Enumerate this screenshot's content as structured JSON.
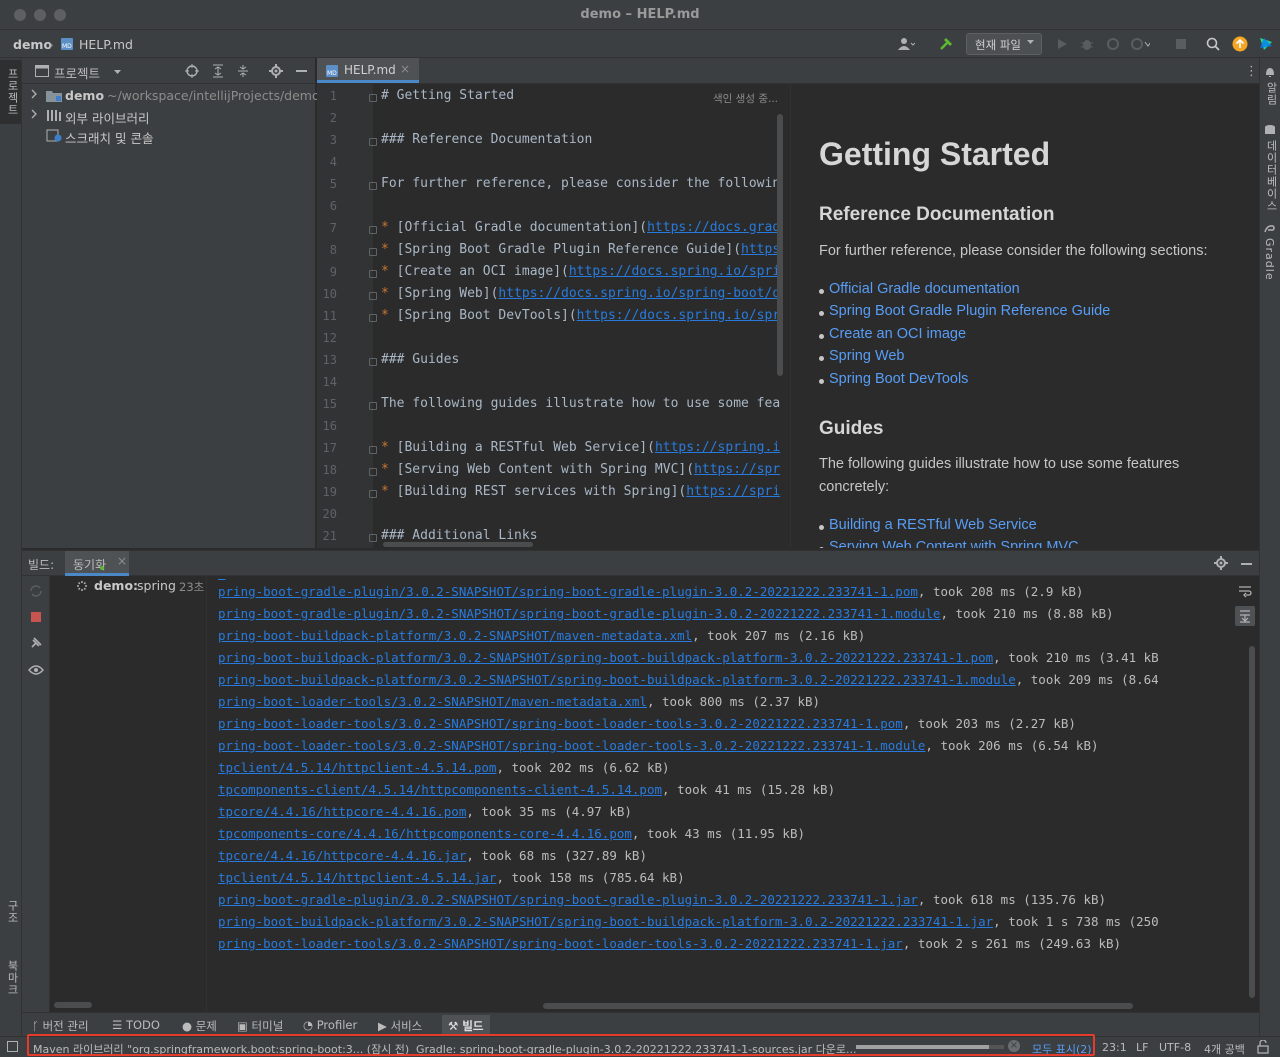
{
  "window": {
    "title": "demo – HELP.md"
  },
  "nav": {
    "project": "demo",
    "file": "HELP.md",
    "run_config": "현재 파일"
  },
  "left_strip": {
    "project_tab": "프로젝트",
    "structure_tab": "구조",
    "bookmarks_tab": "북마크"
  },
  "right_strip": {
    "notifications_tab": "알림",
    "database_tab": "데이터베이스",
    "gradle_tab": "Gradle"
  },
  "project_panel": {
    "title": "프로젝트",
    "tree": [
      {
        "name": "demo",
        "path": "~/workspace/intellijProjects/demo"
      },
      {
        "name": "외부 라이브러리"
      },
      {
        "name": "스크래치 및 콘솔"
      }
    ]
  },
  "editor": {
    "tab": "HELP.md",
    "indexing": "색인 생성 중...",
    "lines": [
      {
        "n": "1",
        "parts": [
          {
            "t": "# Getting Started",
            "c": "plain"
          }
        ]
      },
      {
        "n": "2",
        "parts": []
      },
      {
        "n": "3",
        "parts": [
          {
            "t": "### Reference Documentation",
            "c": "plain"
          }
        ]
      },
      {
        "n": "4",
        "parts": []
      },
      {
        "n": "5",
        "parts": [
          {
            "t": "For further reference, please consider the followin",
            "c": "plain"
          }
        ]
      },
      {
        "n": "6",
        "parts": []
      },
      {
        "n": "7",
        "parts": [
          {
            "t": "* ",
            "c": "star"
          },
          {
            "t": "[Official Gradle documentation](",
            "c": "plain"
          },
          {
            "t": "https://docs.grad",
            "c": "link"
          }
        ]
      },
      {
        "n": "8",
        "parts": [
          {
            "t": "* ",
            "c": "star"
          },
          {
            "t": "[Spring Boot Gradle Plugin Reference Guide](",
            "c": "plain"
          },
          {
            "t": "https",
            "c": "link"
          }
        ]
      },
      {
        "n": "9",
        "parts": [
          {
            "t": "* ",
            "c": "star"
          },
          {
            "t": "[Create an OCI image](",
            "c": "plain"
          },
          {
            "t": "https://docs.spring.io/spri",
            "c": "link"
          }
        ]
      },
      {
        "n": "10",
        "parts": [
          {
            "t": "* ",
            "c": "star"
          },
          {
            "t": "[Spring Web](",
            "c": "plain"
          },
          {
            "t": "https://docs.spring.io/spring-boot/d",
            "c": "link"
          }
        ]
      },
      {
        "n": "11",
        "parts": [
          {
            "t": "* ",
            "c": "star"
          },
          {
            "t": "[Spring Boot DevTools](",
            "c": "plain"
          },
          {
            "t": "https://docs.spring.io/spr",
            "c": "link"
          }
        ]
      },
      {
        "n": "12",
        "parts": []
      },
      {
        "n": "13",
        "parts": [
          {
            "t": "### Guides",
            "c": "plain"
          }
        ]
      },
      {
        "n": "14",
        "parts": []
      },
      {
        "n": "15",
        "parts": [
          {
            "t": "The following guides illustrate how to use some fea",
            "c": "plain"
          }
        ]
      },
      {
        "n": "16",
        "parts": []
      },
      {
        "n": "17",
        "parts": [
          {
            "t": "* ",
            "c": "star"
          },
          {
            "t": "[Building a RESTful Web Service](",
            "c": "plain"
          },
          {
            "t": "https://spring.i",
            "c": "link"
          }
        ]
      },
      {
        "n": "18",
        "parts": [
          {
            "t": "* ",
            "c": "star"
          },
          {
            "t": "[Serving Web Content with Spring MVC](",
            "c": "plain"
          },
          {
            "t": "https://spr",
            "c": "link"
          }
        ]
      },
      {
        "n": "19",
        "parts": [
          {
            "t": "* ",
            "c": "star"
          },
          {
            "t": "[Building REST services with Spring](",
            "c": "plain"
          },
          {
            "t": "https://spri",
            "c": "link"
          }
        ]
      },
      {
        "n": "20",
        "parts": []
      },
      {
        "n": "21",
        "parts": [
          {
            "t": "### Additional Links",
            "c": "plain"
          }
        ]
      }
    ]
  },
  "preview": {
    "h1": "Getting Started",
    "h2_ref": "Reference Documentation",
    "p_ref": "For further reference, please consider the following sections:",
    "ref_links": [
      "Official Gradle documentation",
      "Spring Boot Gradle Plugin Reference Guide",
      "Create an OCI image",
      "Spring Web",
      "Spring Boot DevTools"
    ],
    "h2_guides": "Guides",
    "p_guides_1": "The following guides illustrate how to use some features",
    "p_guides_2": "concretely:",
    "guide_links": [
      "Building a RESTful Web Service",
      "Serving Web Content with Spring MVC"
    ]
  },
  "build": {
    "label": "빌드:",
    "tab": "동기화",
    "tree_item_name": "demo:",
    "tree_item_rest": "spring",
    "tree_item_time": "23초",
    "log": [
      {
        "link": "pring-boot-gradle-plugin/3.0.2-SNAPSHOT/spring-boot-gradle-plugin-3.0.2-20221222.233741-1.pom",
        "rest": ", took 208 ms (2.9 kB)"
      },
      {
        "link": "pring-boot-gradle-plugin/3.0.2-SNAPSHOT/spring-boot-gradle-plugin-3.0.2-20221222.233741-1.module",
        "rest": ", took 210 ms (8.88 kB)"
      },
      {
        "link": "pring-boot-buildpack-platform/3.0.2-SNAPSHOT/maven-metadata.xml",
        "rest": ", took 207 ms (2.16 kB)"
      },
      {
        "link": "pring-boot-buildpack-platform/3.0.2-SNAPSHOT/spring-boot-buildpack-platform-3.0.2-20221222.233741-1.pom",
        "rest": ", took 210 ms (3.41 kB"
      },
      {
        "link": "pring-boot-buildpack-platform/3.0.2-SNAPSHOT/spring-boot-buildpack-platform-3.0.2-20221222.233741-1.module",
        "rest": ", took 209 ms (8.64"
      },
      {
        "link": "pring-boot-loader-tools/3.0.2-SNAPSHOT/maven-metadata.xml",
        "rest": ", took 800 ms (2.37 kB)"
      },
      {
        "link": "pring-boot-loader-tools/3.0.2-SNAPSHOT/spring-boot-loader-tools-3.0.2-20221222.233741-1.pom",
        "rest": ", took 203 ms (2.27 kB)"
      },
      {
        "link": "pring-boot-loader-tools/3.0.2-SNAPSHOT/spring-boot-loader-tools-3.0.2-20221222.233741-1.module",
        "rest": ", took 206 ms (6.54 kB)"
      },
      {
        "link": "tpclient/4.5.14/httpclient-4.5.14.pom",
        "rest": ", took 202 ms (6.62 kB)"
      },
      {
        "link": "tpcomponents-client/4.5.14/httpcomponents-client-4.5.14.pom",
        "rest": ", took 41 ms (15.28 kB)"
      },
      {
        "link": "tpcore/4.4.16/httpcore-4.4.16.pom",
        "rest": ", took 35 ms (4.97 kB)"
      },
      {
        "link": "tpcomponents-core/4.4.16/httpcomponents-core-4.4.16.pom",
        "rest": ", took 43 ms (11.95 kB)"
      },
      {
        "link": "tpcore/4.4.16/httpcore-4.4.16.jar",
        "rest": ", took 68 ms (327.89 kB)"
      },
      {
        "link": "tpclient/4.5.14/httpclient-4.5.14.jar",
        "rest": ", took 158 ms (785.64 kB)"
      },
      {
        "link": "pring-boot-gradle-plugin/3.0.2-SNAPSHOT/spring-boot-gradle-plugin-3.0.2-20221222.233741-1.jar",
        "rest": ", took 618 ms (135.76 kB)"
      },
      {
        "link": "pring-boot-buildpack-platform/3.0.2-SNAPSHOT/spring-boot-buildpack-platform-3.0.2-20221222.233741-1.jar",
        "rest": ", took 1 s 738 ms (250"
      },
      {
        "link": "pring-boot-loader-tools/3.0.2-SNAPSHOT/spring-boot-loader-tools-3.0.2-20221222.233741-1.jar",
        "rest": ", took 2 s 261 ms (249.63 kB)"
      }
    ]
  },
  "tool_windows": {
    "vcs": "버전 관리",
    "todo": "TODO",
    "problems": "문제",
    "terminal": "터미널",
    "profiler": "Profiler",
    "services": "서비스",
    "build": "빌드"
  },
  "status": {
    "maven_msg": "Maven 라이브러리 \"org.springframework.boot:spring-boot:3... (잠시 전)",
    "gradle_msg": "Gradle: spring-boot-gradle-plugin-3.0.2-20221222.233741-1-sources.jar 다운로...",
    "progress_fraction": 0.9,
    "show_all": "모두 표시(2)",
    "position": "23:1",
    "line_sep": "LF",
    "encoding": "UTF-8",
    "indent": "4개 공백"
  },
  "colors": {
    "accent_link": "#287bde",
    "highlight_border": "#e53b2c",
    "build_tab_dot": "#5fb832",
    "update_badge": "#f5a623"
  }
}
